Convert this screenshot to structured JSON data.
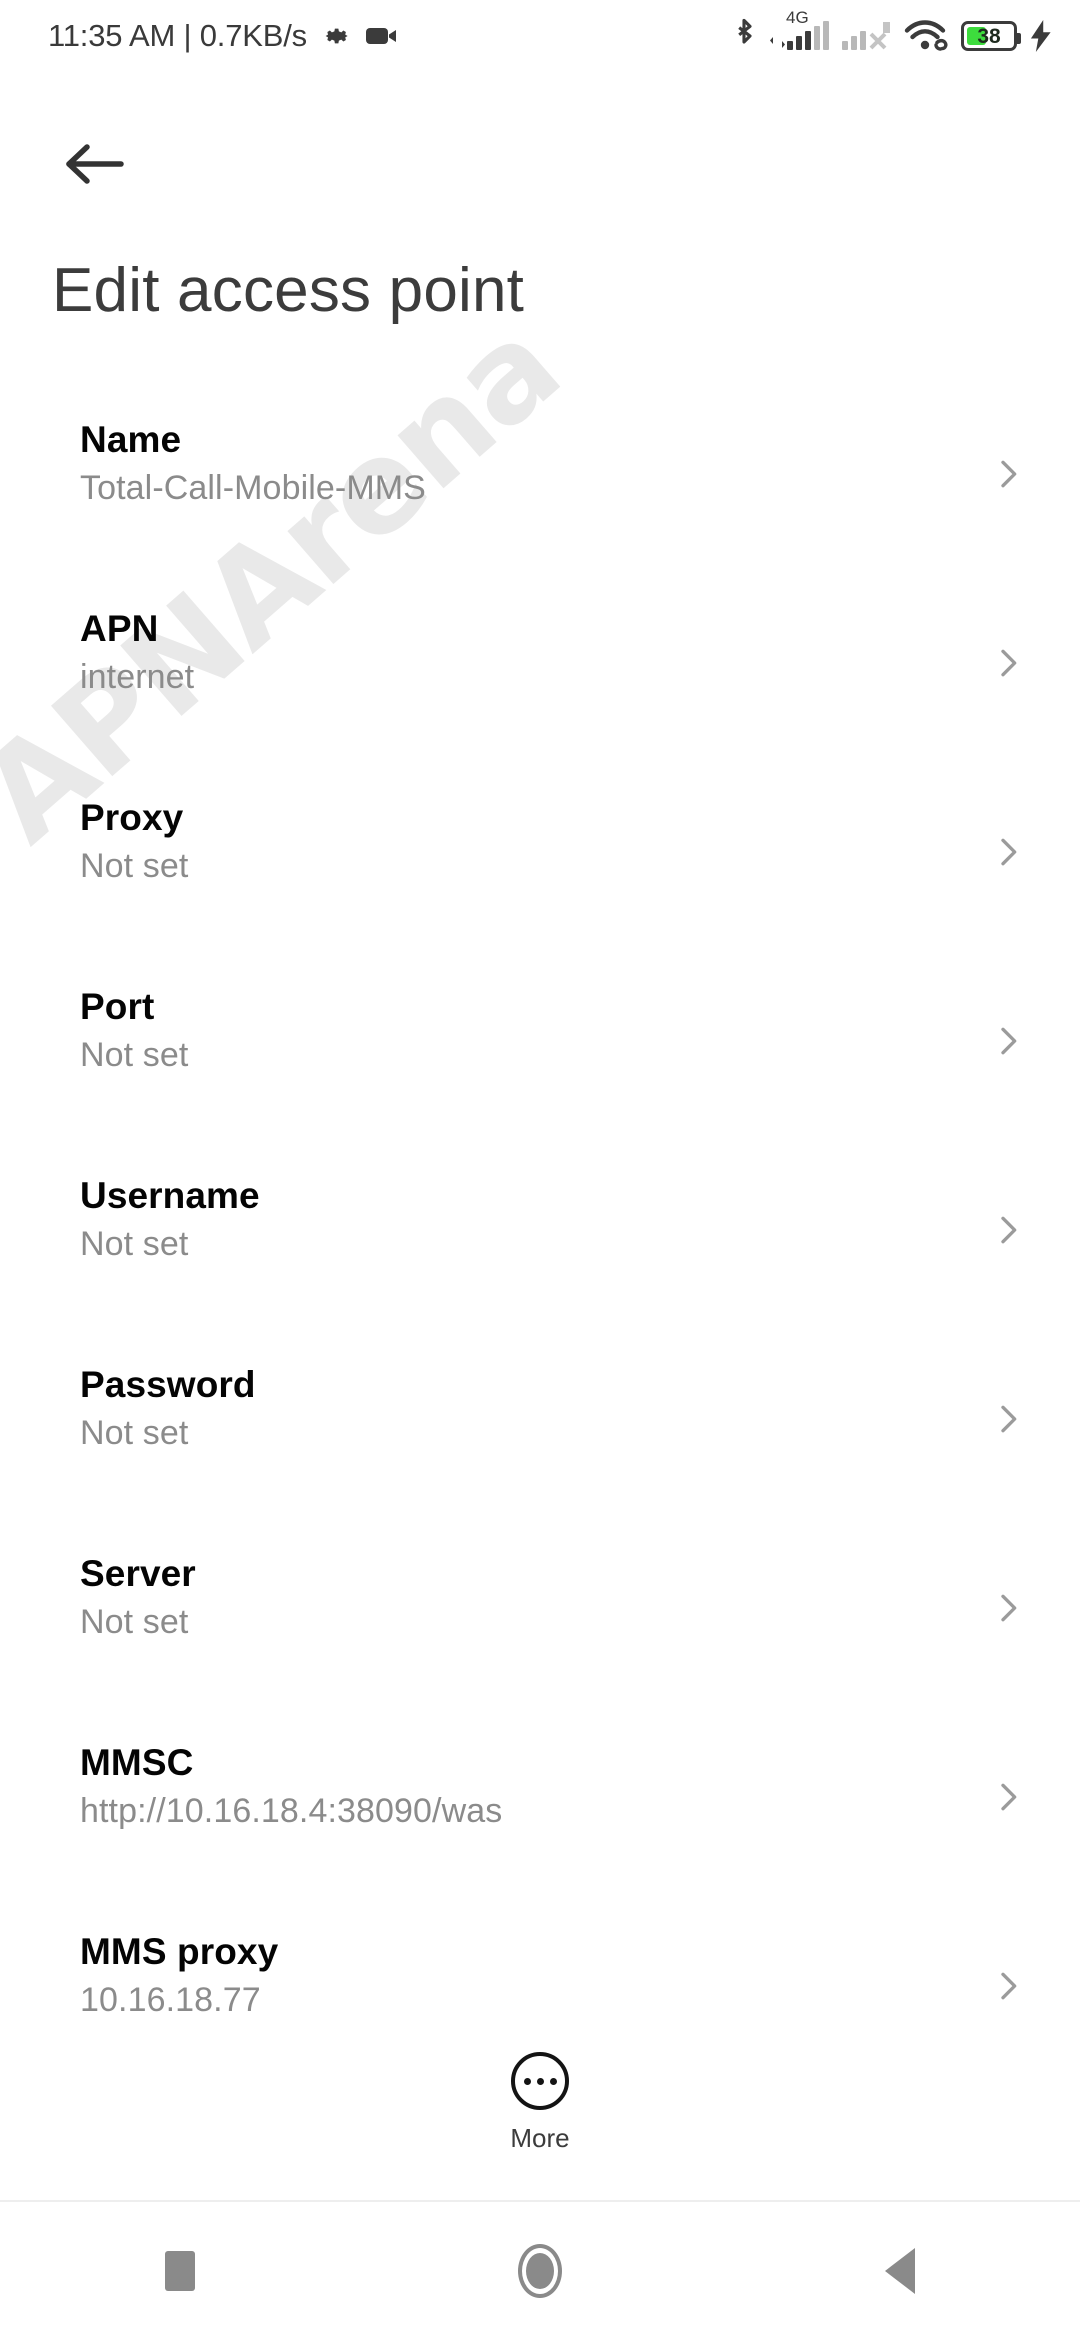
{
  "statusbar": {
    "clock_and_net": "11:35 AM | 0.7KB/s",
    "gear_icon": "gear-icon",
    "camera_icon": "video-camera-icon",
    "bluetooth_icon": "bluetooth-icon",
    "sim1_network_label": "4G",
    "sim1_signal_icon": "signal-bars-icon",
    "sim2_signal_icon": "signal-bars-no-service-icon",
    "wifi_icon": "wifi-icon",
    "wifi_link_icon": "link-icon",
    "battery_level": "38",
    "battery_color": "#3ddc3d",
    "charging_icon": "lightning-bolt-icon"
  },
  "header": {
    "back_icon": "arrow-left-icon",
    "title": "Edit access point"
  },
  "watermark": {
    "text": "APNArena",
    "logo_icon": "wifi-arc-icon",
    "color": "#e9e9e9"
  },
  "list": {
    "chevron_icon": "chevron-right-icon",
    "items": [
      {
        "title": "Name",
        "value": "Total-Call-Mobile-MMS"
      },
      {
        "title": "APN",
        "value": "internet"
      },
      {
        "title": "Proxy",
        "value": "Not set"
      },
      {
        "title": "Port",
        "value": "Not set"
      },
      {
        "title": "Username",
        "value": "Not set"
      },
      {
        "title": "Password",
        "value": "Not set"
      },
      {
        "title": "Server",
        "value": "Not set"
      },
      {
        "title": "MMSC",
        "value": "http://10.16.18.4:38090/was"
      },
      {
        "title": "MMS proxy",
        "value": "10.16.18.77"
      }
    ]
  },
  "more": {
    "label": "More",
    "icon": "more-horizontal-circle-icon"
  },
  "navbar": {
    "recents_icon": "square-recents-icon",
    "home_icon": "circle-home-icon",
    "back_icon": "triangle-back-icon"
  }
}
